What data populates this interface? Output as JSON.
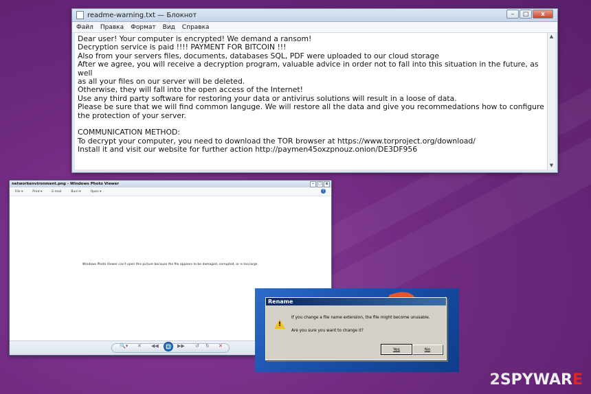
{
  "notepad": {
    "title": "readme-warning.txt — Блокнот",
    "menu": [
      "Файл",
      "Правка",
      "Формат",
      "Вид",
      "Справка"
    ],
    "controls": {
      "minimize": "–",
      "maximize": "□",
      "close": "x"
    },
    "content": "Dear user! Your computer is encrypted! We demand a ransom!\nDecryption service is paid !!!! PAYMENT FOR BITCOIN !!!\nAlso from your servers files, documents, databases SQL, PDF were uploaded to our cloud storage\nAfter we agree, you will receive a decryption program, valuable advice in order not to fall into this situation in the future, as well\nas all your files on our server will be deleted.\nOtherwise, they will fall into the open access of the Internet!\nUse any third party software for restoring your data or antivirus solutions will result in a loose of data.\nPlease be sure that we will find common languge. We will restore all the data and give you recommedations how to configure\nthe protection of your server.\n\nCOMMUNICATION METHOD:\nTo decrypt your computer, you need to download the TOR browser at https://www.torproject.org/download/\nInstall it and visit our website for further action http://paymen45oxzpnouz.onion/DE3DF956"
  },
  "viewer": {
    "title": "networkenvironment.png - Windows Photo Viewer",
    "menu": [
      "File ▾",
      "Print ▾",
      "E-mail",
      "Burn ▾",
      "Open ▾"
    ],
    "help": "?",
    "message": "Windows Photo Viewer can't open this picture because the file appears to be damaged, corrupted, or is too large."
  },
  "rename_dialog": {
    "title": "Rename",
    "line1": "If you change a file name extension, the file might become unusable.",
    "line2": "Are you sure you want to change it?",
    "yes": "Yes",
    "no": "No"
  },
  "watermark": {
    "part1": "2",
    "part2": "SPYWAR",
    "part3": "E"
  },
  "colors": {
    "background": "#6f2a80",
    "watermark_red": "#e02525",
    "dialog_title": "#0a246a"
  }
}
